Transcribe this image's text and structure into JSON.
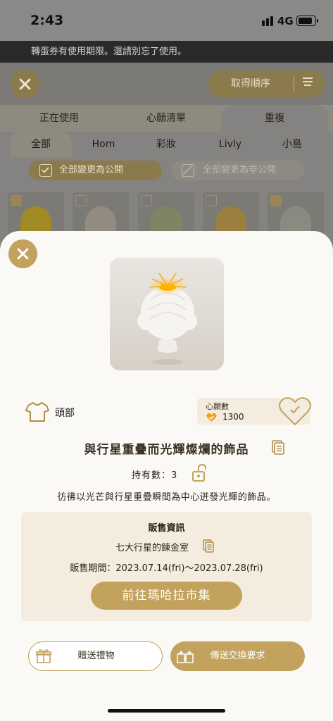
{
  "status_bar": {
    "time": "2:43",
    "network": "4G"
  },
  "notice": "轉蛋券有使用期限。還請別忘了使用。",
  "top_bar": {
    "order_button": "取得順序"
  },
  "tabs": [
    "正在使用",
    "心願清單",
    "重複"
  ],
  "subtabs": [
    "全部",
    "Hom",
    "彩妝",
    "Livly",
    "小島"
  ],
  "bulk_actions": {
    "make_public": "全部變更為公開",
    "make_private": "全部變更為非公開"
  },
  "item": {
    "category": "頭部",
    "wish_label": "心願數",
    "wish_count": "1300",
    "name": "與行星重疊而光輝燦爛的飾品",
    "owned": "持有數：3",
    "description": "彷彿以光芒與行星重疊瞬間為中心迸發光輝的飾品。"
  },
  "sale_info": {
    "title": "販售資訊",
    "shop": "七大行星的鍊金室",
    "period": "販售期間：2023.07.14(fri)～2023.07.28(fri)",
    "go_button": "前往瑪哈拉市集"
  },
  "actions": {
    "gift": "贈送禮物",
    "trade": "傳送交換要求"
  },
  "colors": {
    "accent": "#c2a25d",
    "panel": "#f3ecdf",
    "text": "#3a3224"
  }
}
